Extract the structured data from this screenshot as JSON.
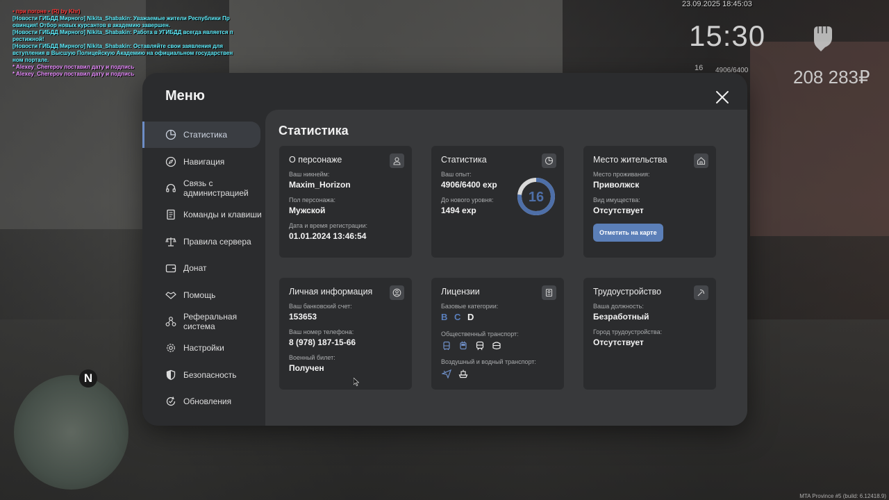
{
  "chat": [
    {
      "text": "• при погоне • (R) by Khr)",
      "color": "red"
    },
    {
      "text": "[Новости ГИБДД Мирного] Nikita_Shabakin: Уважаемые жители Республики Пр",
      "color": "cyan"
    },
    {
      "text": "овинция! Отбор новых курсантов в академию завершен.",
      "color": "cyan"
    },
    {
      "text": "[Новости ГИБДД Мирного] Nikita_Shabakin: Работа в УГИБДД всегда является п",
      "color": "cyan"
    },
    {
      "text": "рестижной!",
      "color": "cyan"
    },
    {
      "text": "[Новости ГИБДД Мирного] Nikita_Shabakin: Оставляйте свои заявления для",
      "color": "cyan"
    },
    {
      "text": " вступления в Высшую Полицейскую Академию на официальном государствен",
      "color": "cyan"
    },
    {
      "text": "ном портале.",
      "color": "cyan"
    },
    {
      "text": " * Alexey_Cherepov поставил дату и подпись",
      "color": "pink"
    },
    {
      "text": " * Alexey_Cherepov поставил дату и подпись",
      "color": "pink"
    }
  ],
  "hud": {
    "date": "23.09.2025 18:45:03",
    "time": "15:30",
    "level": "16",
    "exp": "4906/6400",
    "money": "208 283₽"
  },
  "minimap": {
    "north": "N"
  },
  "build_info": "MTA Province #5 (build: 6.12418.9)",
  "menu": {
    "title": "Меню",
    "sidebar": [
      {
        "label": "Статистика",
        "icon": "pie-chart-icon",
        "active": true
      },
      {
        "label": "Навигация",
        "icon": "compass-icon"
      },
      {
        "label": "Связь с администрацией",
        "icon": "headset-icon"
      },
      {
        "label": "Команды и клавиши",
        "icon": "document-icon"
      },
      {
        "label": "Правила сервера",
        "icon": "scales-icon"
      },
      {
        "label": "Донат",
        "icon": "wallet-icon"
      },
      {
        "label": "Помощь",
        "icon": "handshake-icon"
      },
      {
        "label": "Реферальная система",
        "icon": "network-icon"
      },
      {
        "label": "Настройки",
        "icon": "gear-icon"
      },
      {
        "label": "Безопасность",
        "icon": "shield-icon"
      },
      {
        "label": "Обновления",
        "icon": "refresh-icon"
      }
    ]
  },
  "content": {
    "title": "Статистика",
    "character": {
      "title": "О персонаже",
      "nickname_label": "Ваш никнейм:",
      "nickname": "Maxim_Horizon",
      "gender_label": "Пол персонажа:",
      "gender": "Мужской",
      "reg_label": "Дата и время регистрации:",
      "reg": "01.01.2024 13:46:54"
    },
    "stats": {
      "title": "Статистика",
      "exp_label": "Ваш опыт:",
      "exp": "4906/6400 exp",
      "next_label": "До нового уровня:",
      "next": "1494 exp",
      "level": "16",
      "progress": 0.7666
    },
    "residence": {
      "title": "Место жительства",
      "place_label": "Место проживания:",
      "place": "Приволжск",
      "property_label": "Вид имущества:",
      "property": "Отсутствует",
      "map_button": "Отметить на карте"
    },
    "personal": {
      "title": "Личная информация",
      "bank_label": "Ваш банковский счет:",
      "bank": "153653",
      "phone_label": "Ваш номер телефона:",
      "phone": "8 (978) 187-15-66",
      "military_label": "Военный билет:",
      "military": "Получен"
    },
    "licenses": {
      "title": "Лицензии",
      "base_label": "Базовые категории:",
      "cat_b": "B",
      "cat_c": "C",
      "cat_d": "D",
      "public_label": "Общественный транспорт:",
      "air_label": "Воздушный и водный транспорт:"
    },
    "job": {
      "title": "Трудоустройство",
      "position_label": "Ваша должность:",
      "position": "Безработный",
      "city_label": "Город трудоустройства:",
      "city": "Отсутствует"
    }
  },
  "colors": {
    "accent": "#5b7fb8",
    "panel": "#2b2c2e",
    "content": "#38393b"
  }
}
